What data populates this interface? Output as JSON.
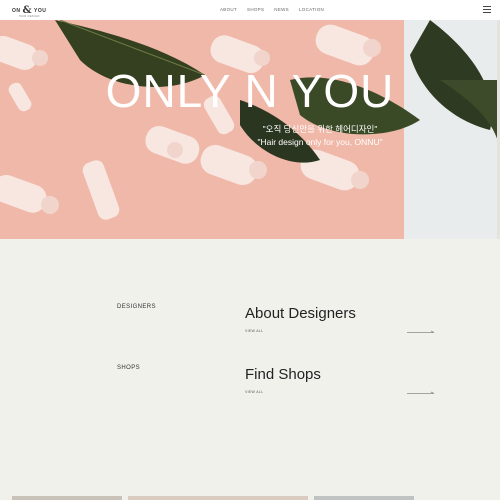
{
  "header": {
    "logo_left": "ON",
    "logo_amp": "&",
    "logo_right": "YOU",
    "logo_sub": "HAIR DESIGN",
    "nav": [
      "ABOUT",
      "SHOPS",
      "NEWS",
      "LOCATION"
    ],
    "menu_icon": "hamburger-menu-icon"
  },
  "hero": {
    "title": "ONLY N YOU",
    "subtitle_ko": "\"오직 당신만을 위한 헤어디자인\"",
    "subtitle_en": "\"Hair design only for you, ONNU\""
  },
  "sections": [
    {
      "label": "DESIGNERS",
      "title": "About Designers",
      "link": "VIEW ALL",
      "arrow_icon": "long-arrow-right-icon"
    },
    {
      "label": "SHOPS",
      "title": "Find Shops",
      "link": "VIEW ALL",
      "arrow_icon": "long-arrow-right-icon"
    }
  ],
  "colors": {
    "background": "#f1f1ec",
    "hero_pink": "#f0b8a8",
    "leaf_green": "#2f3a22",
    "text_dark": "#222222"
  }
}
